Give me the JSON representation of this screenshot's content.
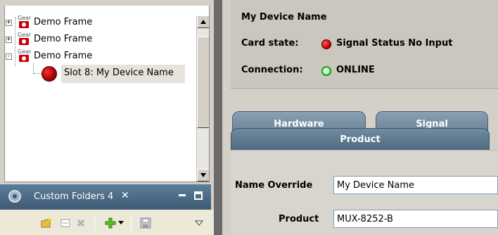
{
  "tree": {
    "items": [
      {
        "label": "Demo Frame",
        "icon": "gear-frame-icon",
        "twisty": "+"
      },
      {
        "label": "Demo Frame",
        "icon": "gear-frame-icon",
        "twisty": "+"
      },
      {
        "label": "Demo Frame",
        "icon": "gear-frame-icon",
        "twisty": "-"
      },
      {
        "label": "Slot 8: My Device Name",
        "icon": "red-status-led-icon"
      }
    ],
    "gear_text": "Gear"
  },
  "custom_folders": {
    "label": "Custom Folders 4",
    "close_glyph": "✕"
  },
  "device": {
    "title": "My Device Name",
    "card_state_label": "Card state:",
    "card_state_value": "Signal Status No Input",
    "card_state_color": "#d00000",
    "connection_label": "Connection:",
    "connection_value": "ONLINE",
    "connection_color": "#1a9a1a"
  },
  "tabs": [
    {
      "label": "Hardware"
    },
    {
      "label": "Signal"
    },
    {
      "label": "Product",
      "active": true
    }
  ],
  "product": {
    "name_override_label": "Name Override",
    "name_override_value": "My Device Name",
    "product_label": "Product",
    "product_value": "MUX-8252-B"
  }
}
